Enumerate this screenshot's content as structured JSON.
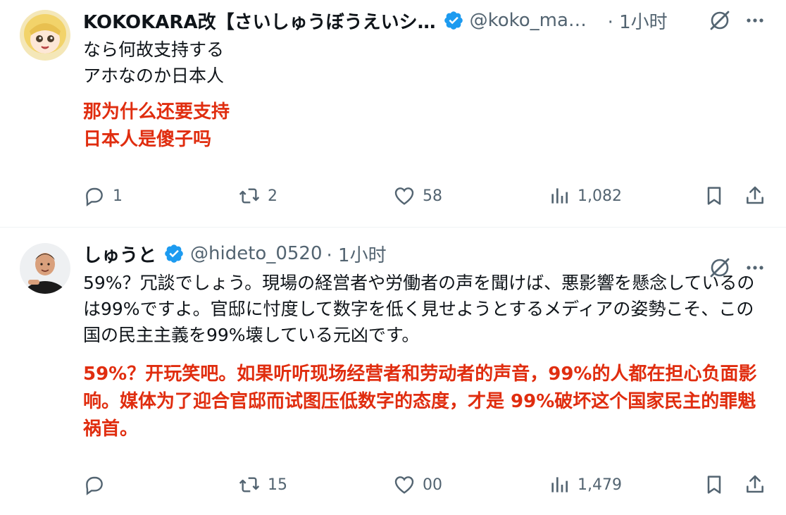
{
  "tweets": [
    {
      "name": "KOKOKARA改【さいしゅうぼうえいシ…",
      "handle": "@koko_mami…",
      "time": "· 1小时",
      "lines_jp": [
        "なら何故支持する",
        "アホなのか日本人"
      ],
      "lines_zh": [
        "那为什么还要支持",
        "日本人是傻子吗"
      ],
      "replies": "1",
      "retweets": "2",
      "likes": "58",
      "views": "1,082"
    },
    {
      "name": "しゅうと",
      "handle": "@hideto_0520",
      "time": "· 1小时",
      "text_jp": "59%？冗談でしょう。現場の経営者や労働者の声を聞けば、悪影響を懸念しているのは99%ですよ。官邸に忖度して数字を低く見せようとするメディアの姿勢こそ、この国の民主主義を99%壊している元凶です。",
      "text_zh": "59%？开玩笑吧。如果听听现场经营者和劳动者的声音，99%的人都在担心负面影响。媒体为了迎合官邸而试图压低数字的态度，才是 99%破坏这个国家民主的罪魁祸首。",
      "replies": "",
      "retweets": "15",
      "likes": "00",
      "views": "1,479"
    }
  ],
  "colors": {
    "translation": "#e02d0f",
    "secondary": "#536471",
    "verified": "#1d9bf0"
  }
}
